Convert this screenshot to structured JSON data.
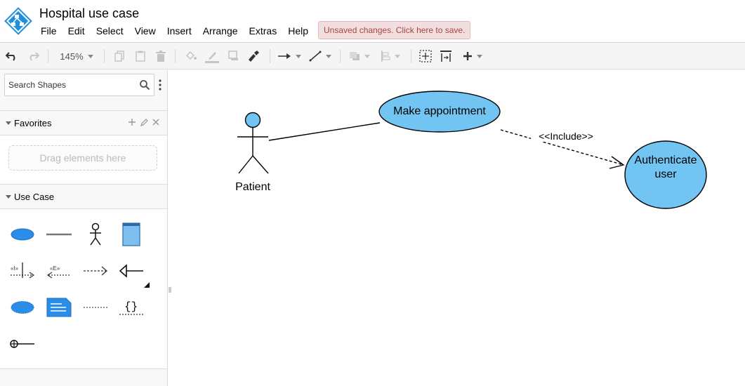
{
  "app": {
    "title": "Hospital use case"
  },
  "menu": {
    "items": [
      "File",
      "Edit",
      "Select",
      "View",
      "Insert",
      "Arrange",
      "Extras",
      "Help"
    ]
  },
  "save_notice": "Unsaved changes. Click here to save.",
  "toolbar": {
    "zoom": "145%",
    "buttons": [
      "undo-icon",
      "redo-icon",
      "zoom-dropdown",
      "copy-icon",
      "paste-icon",
      "delete-icon",
      "fill-color-icon",
      "line-color-icon",
      "shadow-icon",
      "format-painter-icon",
      "connection-arrow-icon",
      "waypoint-icon",
      "to-front-icon",
      "align-icon",
      "fit-icon",
      "page-width-icon",
      "insert-icon"
    ]
  },
  "sidebar": {
    "search_placeholder": "Search Shapes",
    "favorites": {
      "label": "Favorites",
      "drop_hint": "Drag elements here"
    },
    "use_case": {
      "label": "Use Case",
      "shapes": [
        "ellipse",
        "line",
        "actor",
        "document",
        "include-dashed-arrow",
        "extend-dashed-arrow",
        "dashed-arrow",
        "generalization-arrow",
        "cloud-ellipse",
        "note",
        "dashed-line",
        "braces-constraint",
        "interface-lollipop"
      ]
    }
  },
  "diagram": {
    "actor": {
      "label": "Patient"
    },
    "use_cases": [
      {
        "label": "Make appointment"
      },
      {
        "label_line1": "Authenticate",
        "label_line2": "user"
      }
    ],
    "relations": [
      {
        "label": "<<Include>>"
      }
    ],
    "colors": {
      "fill": "#72c4f2",
      "stroke": "#000000",
      "accent": "#2a8de8"
    }
  }
}
